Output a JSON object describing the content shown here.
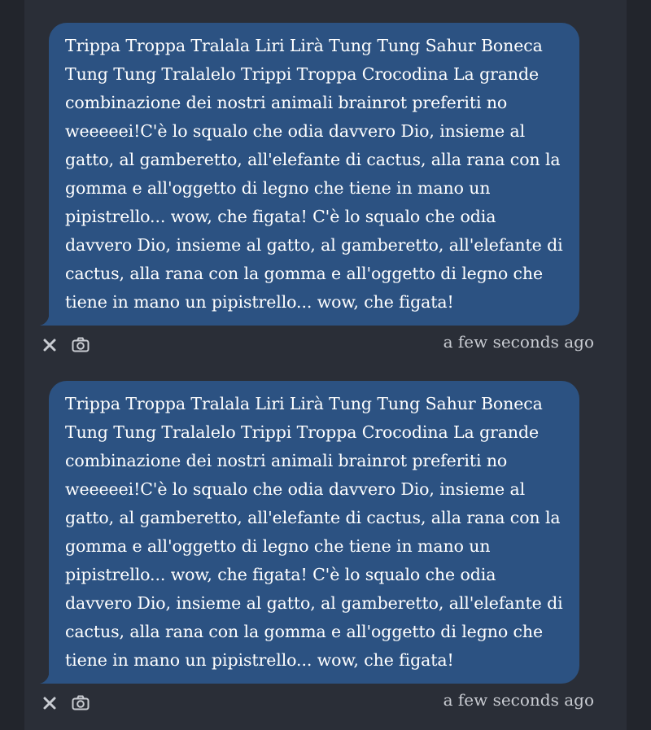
{
  "messages": [
    {
      "text": "Trippa Troppa Tralala Liri Lirà Tung Tung Sahur Boneca Tung Tung Tralalelo Trippi Troppa Crocodina La grande combinazione dei nostri animali brainrot preferiti no weeeeei!C'è lo squalo che odia davvero Dio, insieme al gatto, al gamberetto, all'elefante di cactus, alla rana con la gomma e all'oggetto di legno che tiene in mano un pipistrello... wow, che figata! C'è lo squalo che odia davvero Dio, insieme al gatto, al gamberetto, all'elefante di cactus, alla rana con la gomma e all'oggetto di legno che tiene in mano un pipistrello... wow, che figata!",
      "timestamp": "a few seconds ago"
    },
    {
      "text": "Trippa Troppa Tralala Liri Lirà Tung Tung Sahur Boneca Tung Tung Tralalelo Trippi Troppa Crocodina La grande combinazione dei nostri animali brainrot preferiti no weeeeei!C'è lo squalo che odia davvero Dio, insieme al gatto, al gamberetto, all'elefante di cactus, alla rana con la gomma e all'oggetto di legno che tiene in mano un pipistrello... wow, che figata! C'è lo squalo che odia davvero Dio, insieme al gatto, al gamberetto, all'elefante di cactus, alla rana con la gomma e all'oggetto di legno che tiene in mano un pipistrello... wow, che figata!",
      "timestamp": "a few seconds ago"
    }
  ],
  "icons": {
    "delete": "close-icon",
    "screenshot": "camera-icon"
  },
  "colors": {
    "background": "#2a2e37",
    "bubble": "#2c5282",
    "timestamp": "#c9ccd2"
  }
}
